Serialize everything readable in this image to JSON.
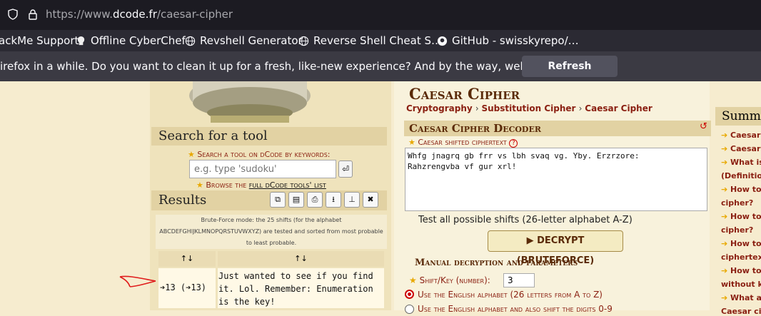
{
  "browser": {
    "url_prefix": "https://www.",
    "url_domain": "dcode.fr",
    "url_path": "/caesar-cipher"
  },
  "bookmarks": [
    {
      "label": "ackMe Support",
      "icon": "none"
    },
    {
      "label": "Offline CyberChef",
      "icon": "chef-icon"
    },
    {
      "label": "Revshell Generator",
      "icon": "globe-icon"
    },
    {
      "label": "Reverse Shell Cheat S…",
      "icon": "globe-icon"
    },
    {
      "label": "GitHub - swisskyrepo/…",
      "icon": "github-icon"
    }
  ],
  "notification": {
    "message": "irefox in a while. Do you want to clean it up for a fresh, like-new experience? And by the way, welcome back!",
    "button": "Refresh Firefox…"
  },
  "sidebar": {
    "search_title": "Search for a tool",
    "search_label": "Search a tool on dCode by keywords:",
    "search_placeholder": "e.g. type 'sudoku'",
    "browse_prefix": "Browse the ",
    "browse_link": "full dCode tools' list",
    "results_title": "Results",
    "brute_info_1": "Brute-Force mode: the 25 shifts (for the alphabet",
    "brute_info_2": "ABCDEFGHIJKLMNOPQRSTUVWXYZ) are tested and sorted from most probable",
    "brute_info_3": "to least probable.",
    "col1_header": "↑↓",
    "col2_header": "↑↓",
    "row_shift": "➔13 (➔13)",
    "row_text": "Just wanted to see if you find it. Lol. Remember: Enumeration is the key!"
  },
  "main": {
    "title": "Caesar Cipher",
    "breadcrumb": [
      "Cryptography",
      "Substitution Cipher",
      "Caesar Cipher"
    ],
    "decoder_title": "Caesar Cipher Decoder",
    "cipher_label": "Caesar shifted ciphertext",
    "ciphertext": "Whfg jnagrq gb frr vs lbh svaq vg. Yby. Erzrzore:\nRahzrengvba vf gur xrl!",
    "test_all": "Test all possible shifts (26-letter alphabet A-Z)",
    "decrypt_button": "▶ DECRYPT (BRUTEFORCE)",
    "manual_title": "Manual decryption and parameters",
    "shift_label": "Shift/Key (number):",
    "shift_value": "3",
    "option_1": "Use the English alphabet (26 letters from A to Z)",
    "option_2": "Use the English alphabet and also shift the digits 0-9"
  },
  "summary": {
    "title": "Summary",
    "items": [
      "Caesar C",
      "Caesar C",
      "What is",
      "(Definition)",
      "How to",
      "cipher?",
      "How to",
      "cipher?",
      "How to",
      "ciphertext?",
      "How to",
      "without kn",
      "What ar",
      "Caesar cip"
    ]
  },
  "colors": {
    "accent": "#8a1f11",
    "heading": "#5a2a08",
    "annotation": "#e01b1b"
  }
}
